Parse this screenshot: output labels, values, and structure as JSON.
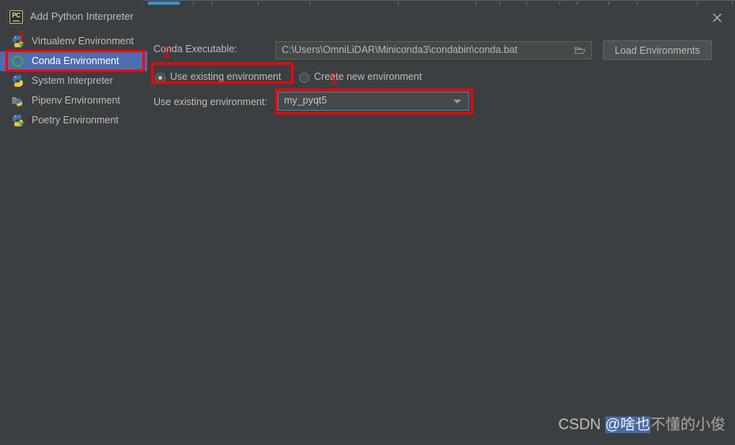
{
  "window": {
    "title": "Add Python Interpreter",
    "app_icon": "pycharm-icon",
    "close_icon": "close-icon"
  },
  "sidebar": {
    "items": [
      {
        "label": "Virtualenv Environment",
        "icon": "python-virtualenv-icon",
        "selected": false
      },
      {
        "label": "Conda Environment",
        "icon": "conda-circle-icon",
        "selected": true
      },
      {
        "label": "System Interpreter",
        "icon": "python-icon",
        "selected": false
      },
      {
        "label": "Pipenv Environment",
        "icon": "pipenv-folder-icon",
        "selected": false
      },
      {
        "label": "Poetry Environment",
        "icon": "python-poetry-icon",
        "selected": false
      }
    ]
  },
  "form": {
    "conda_executable_label": "Conda Executable:",
    "conda_executable_value": "C:\\Users\\OmniLiDAR\\Miniconda3\\condabin\\conda.bat",
    "browse_icon": "folder-open-icon",
    "load_environments_label": "Load Environments",
    "radio_use_existing_label": "Use existing environment",
    "radio_create_new_label": "Create new environment",
    "use_existing_env_label": "Use existing environment:",
    "selected_environment": "my_pyqt5",
    "dropdown_icon": "chevron-down-icon"
  },
  "annotations": {
    "color": "#ff0000",
    "markers": [
      {
        "number": "1",
        "target": "conda-environment-sidebar-item"
      },
      {
        "number": "2",
        "target": "use-existing-environment-radio"
      },
      {
        "number": "3",
        "target": "environment-combobox"
      }
    ]
  },
  "watermark": {
    "prefix": "CSDN ",
    "handle_highlight": "@啥也",
    "handle_rest": "不懂的小俊"
  }
}
